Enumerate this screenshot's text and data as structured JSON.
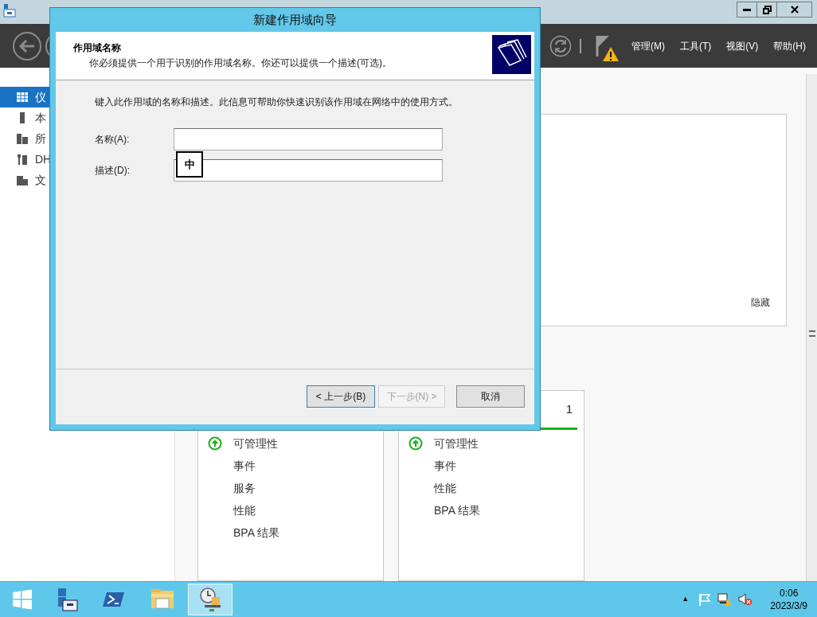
{
  "toolbar": {
    "menus": [
      "管理(M)",
      "工具(T)",
      "视图(V)",
      "帮助(H)"
    ]
  },
  "sidebar": {
    "items": [
      {
        "label": "仪",
        "kind": "dashboard",
        "selected": true
      },
      {
        "label": "本",
        "kind": "server",
        "selected": false
      },
      {
        "label": "所",
        "kind": "servers",
        "selected": false
      },
      {
        "label": "DH",
        "kind": "dhcp",
        "selected": false
      },
      {
        "label": "文",
        "kind": "files",
        "selected": false
      }
    ]
  },
  "welcome_panel": {
    "hide_link": "隐藏"
  },
  "tiles": [
    {
      "items": [
        {
          "label": "可管理性",
          "kind": "status"
        },
        {
          "label": "事件",
          "kind": "plain"
        },
        {
          "label": "服务",
          "kind": "plain"
        },
        {
          "label": "性能",
          "kind": "plain"
        },
        {
          "label": "BPA 结果",
          "kind": "plain"
        }
      ]
    },
    {
      "count": "1",
      "items": [
        {
          "label": "可管理性",
          "kind": "status"
        },
        {
          "label": "事件",
          "kind": "plain"
        },
        {
          "label": "性能",
          "kind": "plain"
        },
        {
          "label": "BPA 结果",
          "kind": "plain"
        }
      ]
    }
  ],
  "dialog": {
    "title": "新建作用域向导",
    "header_title": "作用域名称",
    "header_subtitle": "你必须提供一个用于识别的作用域名称。你还可以提供一个描述(可选)。",
    "instruction": "键入此作用域的名称和描述。此信息可帮助你快速识别该作用域在网络中的使用方式。",
    "fields": [
      {
        "label": "名称(A):"
      },
      {
        "label": "描述(D):"
      }
    ],
    "ime_indicator": "中",
    "buttons": [
      {
        "label": "< 上一步(B)",
        "disabled": false,
        "default": true
      },
      {
        "label": "下一步(N) >",
        "disabled": true,
        "default": false
      },
      {
        "label": "取消",
        "disabled": false,
        "default": false
      }
    ]
  },
  "taskbar": {
    "apps": [
      {
        "kind": "server_manager",
        "selected": false
      },
      {
        "kind": "powershell",
        "selected": false
      },
      {
        "kind": "explorer",
        "selected": false
      },
      {
        "kind": "dhcp",
        "selected": true
      }
    ],
    "tray_arrow": "▲",
    "time": "0:06",
    "date": "2023/3/9"
  }
}
